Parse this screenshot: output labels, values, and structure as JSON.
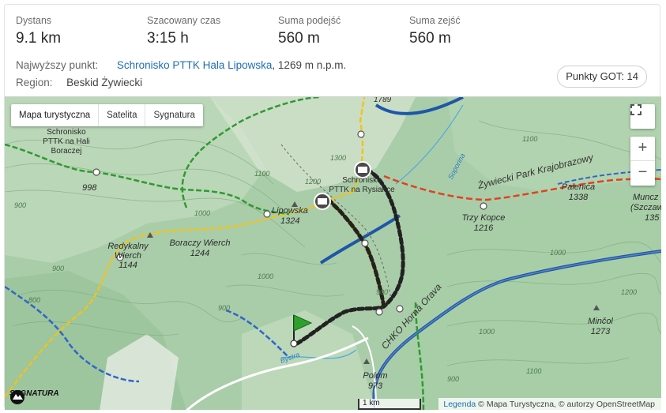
{
  "stats": [
    {
      "label": "Dystans",
      "value": "9.1 km"
    },
    {
      "label": "Szacowany czas",
      "value": "3:15 h"
    },
    {
      "label": "Suma podejść",
      "value": "560 m"
    },
    {
      "label": "Suma zejść",
      "value": "560 m"
    }
  ],
  "highest_point": {
    "label": "Najwyższy punkt:",
    "link": "Schronisko PTTK Hala Lipowska",
    "rest": ", 1269 m n.p.m."
  },
  "region": {
    "label": "Region:",
    "value": "Beskid Żywiecki"
  },
  "got_badge": "Punkty GOT: 14",
  "map": {
    "types": [
      "Mapa turystyczna",
      "Satelita",
      "Sygnatura"
    ],
    "active_type": "Mapa turystyczna",
    "zoom_in": "+",
    "zoom_out": "−",
    "scale": "1 km",
    "attribution_link": "Legenda",
    "attribution_text": " © Mapa Turystyczna, © autorzy OpenStreetMap",
    "logo_text": "SYGNATURA",
    "labels": {
      "shelter_boracza": "Schronisko PTTK na Hali Boraczej",
      "shelter_rysianka": "Schronisko PTTK na Rysiance",
      "lipowska": "Lipowska",
      "lipowska_h": "1324",
      "reykalny": "Redykalny Wierch",
      "reykalny_h": "1144",
      "boraczy": "Boraczy Wierch",
      "boraczy_h": "1244",
      "trzy_kopce": "Trzy Kopce",
      "trzy_kopce_h": "1216",
      "palenica": "Palenica",
      "palenica_h": "1338",
      "munczolik": "Muncz (Szczaw",
      "munczolik_h": "135",
      "minczol": "Minčol",
      "minczol_h": "1273",
      "polom": "Polom",
      "polom_h": "973",
      "p998": "998",
      "p1789": "1789",
      "park": "Żywiecki Park Krajobrazowy",
      "chko": "CHKO Horná Orava",
      "soporina": "Soporina",
      "bystra": "Bystra"
    },
    "accent_colors": {
      "trail_yellow": "#f2c318",
      "trail_green": "#2f9a2f",
      "trail_blue": "#2f66c9",
      "trail_red": "#e3401f",
      "route": "#222222"
    }
  }
}
